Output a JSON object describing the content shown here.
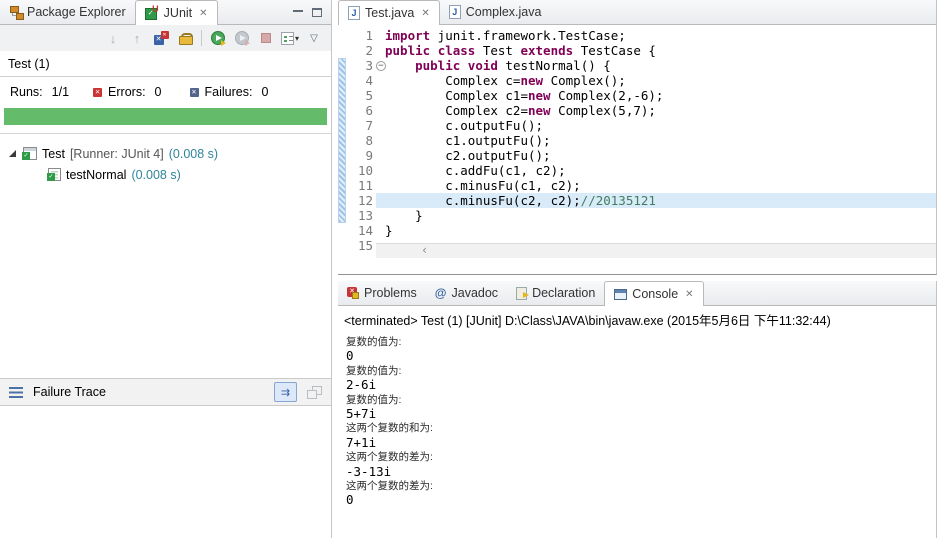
{
  "colors": {
    "progress_green": "#64BB6A",
    "keyword": "#7F0055",
    "comment": "#3F7F5F",
    "time_teal": "#2E8599",
    "line_highlight": "#D9EAF9"
  },
  "left_panel": {
    "tabs": [
      {
        "label": "Package Explorer"
      },
      {
        "label": "JUnit",
        "close": "✕"
      }
    ],
    "summary": {
      "title": "Test (1)",
      "runs_label": "Runs:",
      "runs_value": "1/1",
      "errors_label": "Errors:",
      "errors_value": "0",
      "failures_label": "Failures:",
      "failures_value": "0"
    },
    "tree": [
      {
        "label": "Test",
        "suffix": "[Runner: JUnit 4]",
        "time": "(0.008 s)"
      },
      {
        "label": "testNormal",
        "time": "(0.008 s)"
      }
    ],
    "failure_trace_label": "Failure Trace"
  },
  "editor": {
    "tabs": [
      {
        "label": "Test.java",
        "close": "✕"
      },
      {
        "label": "Complex.java"
      }
    ],
    "lines": [
      {
        "n": 1,
        "seg": [
          [
            "k",
            "import"
          ],
          [
            "p",
            " junit.framework.TestCase;"
          ]
        ]
      },
      {
        "n": 2,
        "seg": [
          [
            "k",
            "public"
          ],
          [
            "p",
            " "
          ],
          [
            "k",
            "class"
          ],
          [
            "p",
            " Test "
          ],
          [
            "k",
            "extends"
          ],
          [
            "p",
            " TestCase {"
          ]
        ]
      },
      {
        "n": 3,
        "fold": true,
        "seg": [
          [
            "p",
            "    "
          ],
          [
            "k",
            "public"
          ],
          [
            "p",
            " "
          ],
          [
            "k",
            "void"
          ],
          [
            "p",
            " testNormal() {"
          ]
        ]
      },
      {
        "n": 4,
        "seg": [
          [
            "p",
            "        Complex c="
          ],
          [
            "k",
            "new"
          ],
          [
            "p",
            " Complex();"
          ]
        ]
      },
      {
        "n": 5,
        "seg": [
          [
            "p",
            "        Complex c1="
          ],
          [
            "k",
            "new"
          ],
          [
            "p",
            " Complex(2,-6);"
          ]
        ]
      },
      {
        "n": 6,
        "seg": [
          [
            "p",
            "        Complex c2="
          ],
          [
            "k",
            "new"
          ],
          [
            "p",
            " Complex(5,7);"
          ]
        ]
      },
      {
        "n": 7,
        "seg": [
          [
            "p",
            "        c.outputFu();"
          ]
        ]
      },
      {
        "n": 8,
        "seg": [
          [
            "p",
            "        c1.outputFu();"
          ]
        ]
      },
      {
        "n": 9,
        "seg": [
          [
            "p",
            "        c2.outputFu();"
          ]
        ]
      },
      {
        "n": 10,
        "seg": [
          [
            "p",
            "        c.addFu(c1, c2);"
          ]
        ]
      },
      {
        "n": 11,
        "seg": [
          [
            "p",
            "        c.minusFu(c1, c2);"
          ]
        ]
      },
      {
        "n": 12,
        "highlight": true,
        "seg": [
          [
            "p",
            "        c.minusFu(c2, c2);"
          ],
          [
            "c",
            "//20135121"
          ]
        ]
      },
      {
        "n": 13,
        "seg": [
          [
            "p",
            "    }"
          ]
        ]
      },
      {
        "n": 14,
        "seg": [
          [
            "p",
            "}"
          ]
        ]
      },
      {
        "n": 15,
        "seg": []
      }
    ]
  },
  "console": {
    "tabs": [
      {
        "label": "Problems"
      },
      {
        "label": "Javadoc"
      },
      {
        "label": "Declaration"
      },
      {
        "label": "Console",
        "close": "✕"
      }
    ],
    "status": "<terminated> Test (1) [JUnit] D:\\Class\\JAVA\\bin\\javaw.exe (2015年5月6日 下午11:32:44)",
    "lines": [
      {
        "type": "label",
        "text": "复数的值为:"
      },
      {
        "type": "value",
        "text": "0"
      },
      {
        "type": "label",
        "text": "复数的值为:"
      },
      {
        "type": "value",
        "text": "2-6i"
      },
      {
        "type": "label",
        "text": "复数的值为:"
      },
      {
        "type": "value",
        "text": "5+7i"
      },
      {
        "type": "label",
        "text": "这两个复数的和为:"
      },
      {
        "type": "value",
        "text": "7+1i"
      },
      {
        "type": "label",
        "text": "这两个复数的差为:"
      },
      {
        "type": "value",
        "text": "-3-13i"
      },
      {
        "type": "label",
        "text": "这两个复数的差为:"
      },
      {
        "type": "value",
        "text": "0"
      }
    ]
  }
}
